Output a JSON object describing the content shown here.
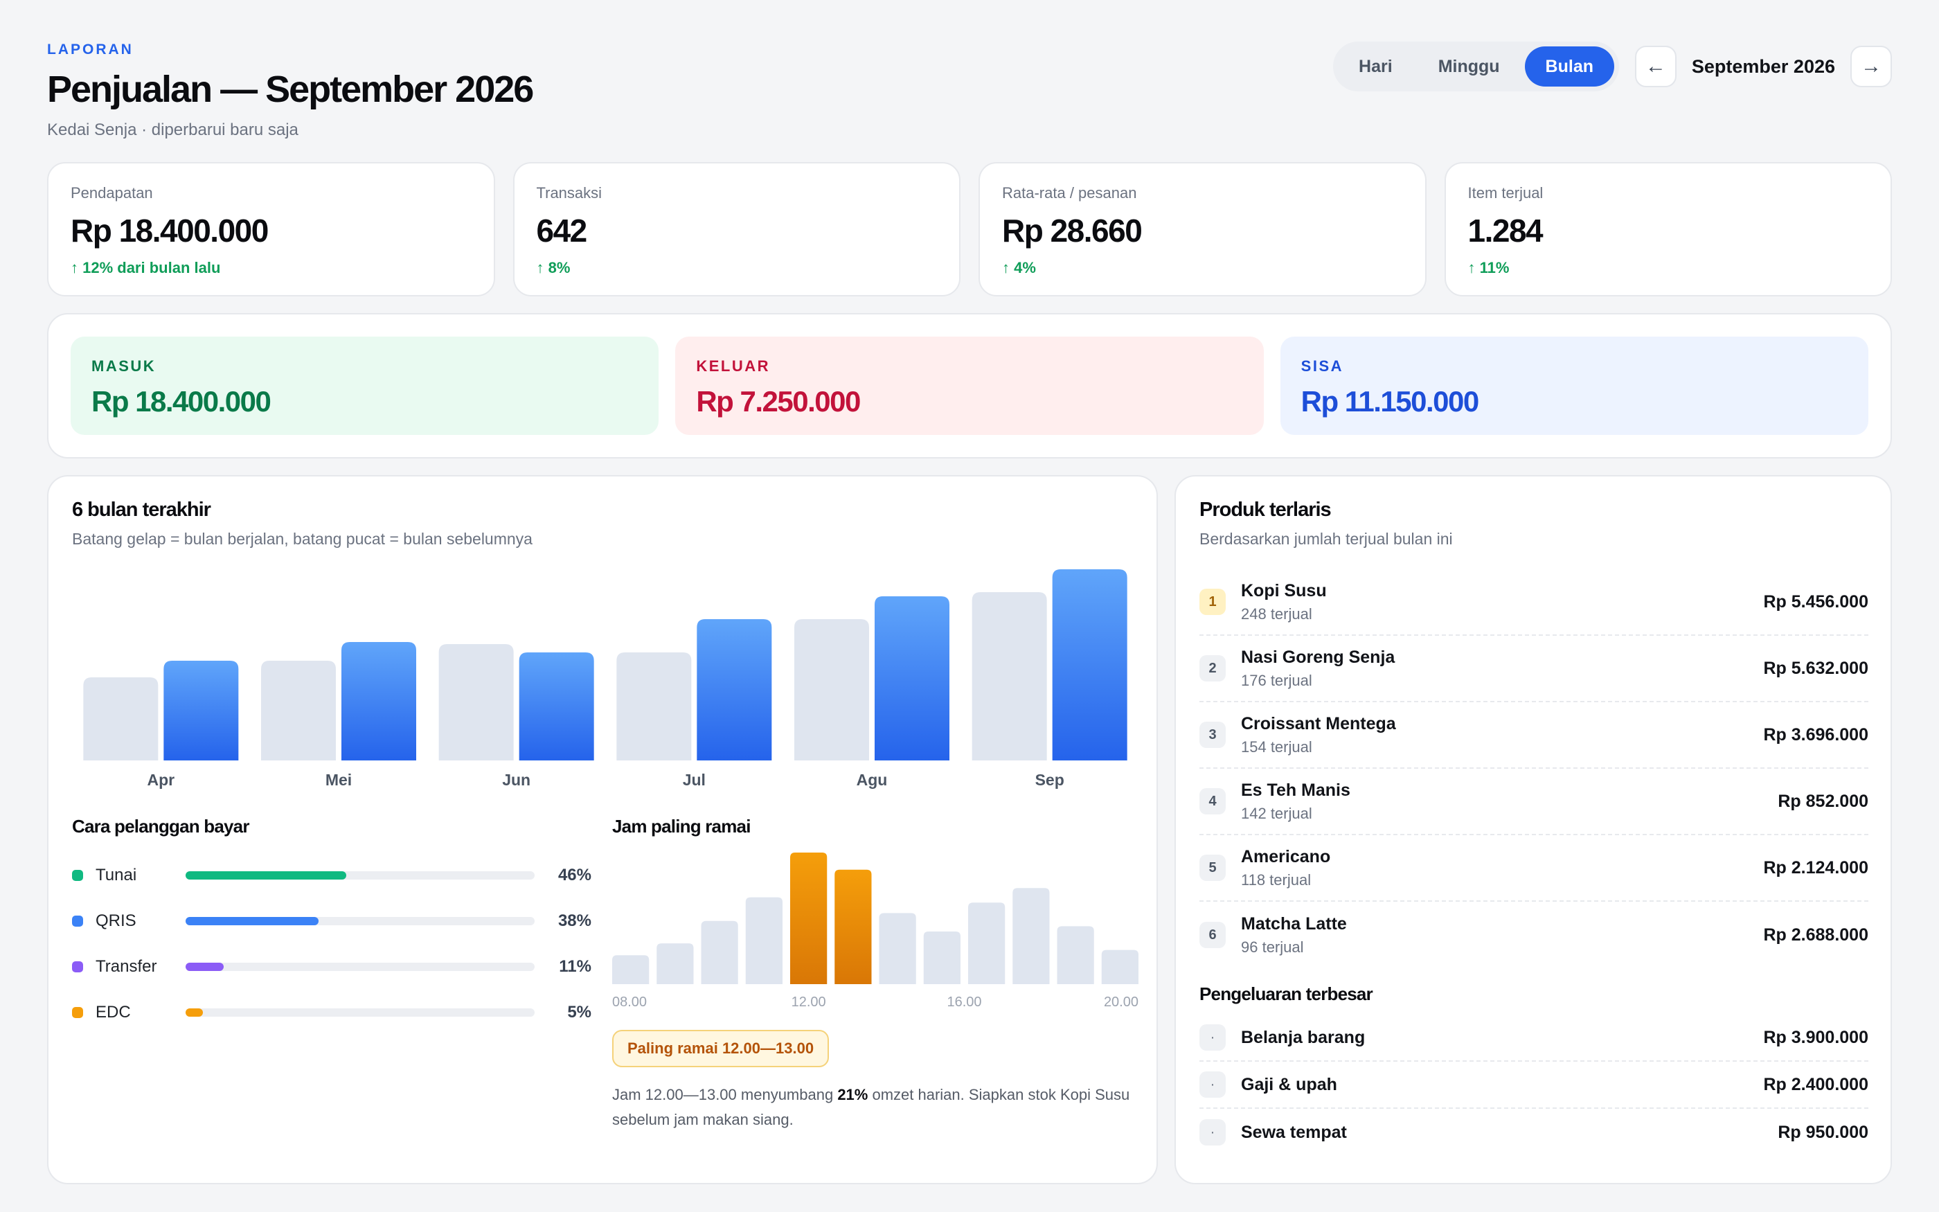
{
  "header": {
    "eyebrow": "LAPORAN",
    "title": "Penjualan — September 2026",
    "subtitle": "Kedai Senja · diperbarui baru saja",
    "range_options": [
      "Hari",
      "Minggu",
      "Bulan"
    ],
    "range_selected": "Bulan",
    "period_label": "September 2026",
    "prev_icon": "arrow-left-icon",
    "next_icon": "arrow-right-icon"
  },
  "kpis": [
    {
      "label": "Pendapatan",
      "value": "Rp 18.400.000",
      "delta": "↑ 12% dari bulan lalu"
    },
    {
      "label": "Transaksi",
      "value": "642",
      "delta": "↑ 8%"
    },
    {
      "label": "Rata-rata / pesanan",
      "value": "Rp 28.660",
      "delta": "↑ 4%"
    },
    {
      "label": "Item terjual",
      "value": "1.284",
      "delta": "↑ 11%"
    }
  ],
  "cashflow": {
    "in": {
      "label": "MASUK",
      "value": "Rp 18.400.000"
    },
    "out": {
      "label": "KELUAR",
      "value": "Rp 7.250.000"
    },
    "rest": {
      "label": "SISA",
      "value": "Rp 11.150.000"
    }
  },
  "trend": {
    "title": "6 bulan terakhir",
    "subtitle": "Batang gelap = bulan berjalan, batang pucat = bulan sebelumnya"
  },
  "payments": {
    "title": "Cara pelanggan bayar",
    "items": [
      {
        "name": "Tunai",
        "pct_label": "46%",
        "pct": 46,
        "color": "#10b981"
      },
      {
        "name": "QRIS",
        "pct_label": "38%",
        "pct": 38,
        "color": "#3b82f6"
      },
      {
        "name": "Transfer",
        "pct_label": "11%",
        "pct": 11,
        "color": "#8b5cf6"
      },
      {
        "name": "EDC",
        "pct_label": "5%",
        "pct": 5,
        "color": "#f59e0b"
      }
    ]
  },
  "busy_hours": {
    "title": "Jam paling ramai",
    "badge": "Paling ramai 12.00—13.00",
    "note_pre": "Jam 12.00—13.00 menyumbang ",
    "note_bold": "21%",
    "note_post": " omzet harian. Siapkan stok Kopi Susu sebelum jam makan siang."
  },
  "top_products": {
    "title": "Produk terlaris",
    "subtitle": "Berdasarkan jumlah terjual bulan ini",
    "items": [
      {
        "rank": "1",
        "name": "Kopi Susu",
        "sold": "248 terjual",
        "amount": "Rp 5.456.000"
      },
      {
        "rank": "2",
        "name": "Nasi Goreng Senja",
        "sold": "176 terjual",
        "amount": "Rp 5.632.000"
      },
      {
        "rank": "3",
        "name": "Croissant Mentega",
        "sold": "154 terjual",
        "amount": "Rp 3.696.000"
      },
      {
        "rank": "4",
        "name": "Es Teh Manis",
        "sold": "142 terjual",
        "amount": "Rp 852.000"
      },
      {
        "rank": "5",
        "name": "Americano",
        "sold": "118 terjual",
        "amount": "Rp 2.124.000"
      },
      {
        "rank": "6",
        "name": "Matcha Latte",
        "sold": "96 terjual",
        "amount": "Rp 2.688.000"
      }
    ]
  },
  "expenses": {
    "title": "Pengeluaran terbesar",
    "items": [
      {
        "name": "Belanja barang",
        "amount": "Rp 3.900.000"
      },
      {
        "name": "Gaji & upah",
        "amount": "Rp 2.400.000"
      },
      {
        "name": "Sewa tempat",
        "amount": "Rp 950.000"
      }
    ]
  },
  "chart_data": [
    {
      "type": "bar",
      "categories": [
        "Apr",
        "Mei",
        "Jun",
        "Jul",
        "Agu",
        "Sep"
      ],
      "series": [
        {
          "values": [
            40,
            48,
            56,
            52,
            68,
            81
          ]
        },
        {
          "values": [
            48,
            57,
            52,
            68,
            79,
            92
          ]
        }
      ],
      "ylim": [
        0,
        100
      ],
      "colors": [
        "#dfe5ef",
        "#2563eb"
      ]
    },
    {
      "type": "bar",
      "x_tick_labels": [
        "08.00",
        "12.00",
        "16.00",
        "20.00"
      ],
      "values": [
        22,
        31,
        48,
        66,
        100,
        87,
        54,
        40,
        62,
        73,
        44,
        26
      ],
      "highlight": [
        4,
        5
      ],
      "ylim": [
        0,
        100
      ],
      "colors": [
        "#dfe5ef",
        "#f59e0b"
      ]
    }
  ]
}
